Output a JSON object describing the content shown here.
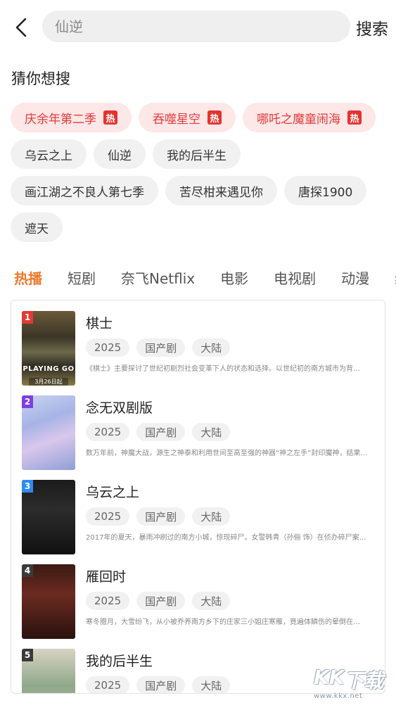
{
  "header": {
    "search_placeholder": "仙逆",
    "search_label": "搜索"
  },
  "guess": {
    "title": "猜你想搜",
    "hot_badge": "热",
    "rows": [
      [
        {
          "label": "庆余年第二季",
          "hot": true
        },
        {
          "label": "吞噬星空",
          "hot": true
        },
        {
          "label": "哪吒之魔童闹海",
          "hot": true
        }
      ],
      [
        {
          "label": "乌云之上",
          "hot": false
        },
        {
          "label": "仙逆",
          "hot": false
        },
        {
          "label": "我的后半生",
          "hot": false
        }
      ],
      [
        {
          "label": "画江湖之不良人第七季",
          "hot": false
        },
        {
          "label": "苦尽柑来遇见你",
          "hot": false
        },
        {
          "label": "唐探1900",
          "hot": false
        }
      ],
      [
        {
          "label": "遮天",
          "hot": false
        }
      ]
    ]
  },
  "tabs": {
    "items": [
      "热播",
      "短剧",
      "奈飞Netflix",
      "电影",
      "电视剧",
      "动漫",
      "综"
    ],
    "active_index": 0
  },
  "list": {
    "items": [
      {
        "rank": "1",
        "rank_color": "#e53935",
        "title": "棋士",
        "year": "2025",
        "genre": "国产剧",
        "region": "大陆",
        "desc": "《棋士》主要探讨了世纪初剧烈社会变革下人的状态和选择。以世纪初的南方城市为背…",
        "poster_text": "PLAYING GO",
        "poster_sub": "3月26日起"
      },
      {
        "rank": "2",
        "rank_color": "#7b3fe4",
        "title": "念无双剧版",
        "year": "2025",
        "genre": "国产剧",
        "region": "大陆",
        "desc": "数万年前，神魔大战，源生之神泰和利用世间至高至强的神器“神之左手”封印魔神，结果…",
        "poster_text": "",
        "poster_sub": ""
      },
      {
        "rank": "3",
        "rank_color": "#2f8bf0",
        "title": "乌云之上",
        "year": "2025",
        "genre": "国产剧",
        "region": "大陆",
        "desc": "2017年的夏天，暴雨冲刷过的南方小城，惊现碎尸。女警韩青（孙俪 饰）在侦办碎尸案…",
        "poster_text": "",
        "poster_sub": ""
      },
      {
        "rank": "4",
        "rank_color": "#3a3a3a",
        "title": "雁回时",
        "year": "2025",
        "genre": "国产剧",
        "region": "大陆",
        "desc": "寒冬腊月，大雪纷飞，从小被乔养南方乡下的庄家三小姐庄寒雁，竟遍体鳞伤的晕倒在…",
        "poster_text": "",
        "poster_sub": ""
      },
      {
        "rank": "5",
        "rank_color": "#3a3a3a",
        "title": "我的后半生",
        "year": "2025",
        "genre": "国产剧",
        "region": "大陆",
        "desc": "",
        "poster_text": "",
        "poster_sub": ""
      }
    ]
  },
  "watermark": {
    "chars": [
      "K",
      "K",
      "下",
      "载"
    ],
    "url": "www.kkx.net"
  }
}
